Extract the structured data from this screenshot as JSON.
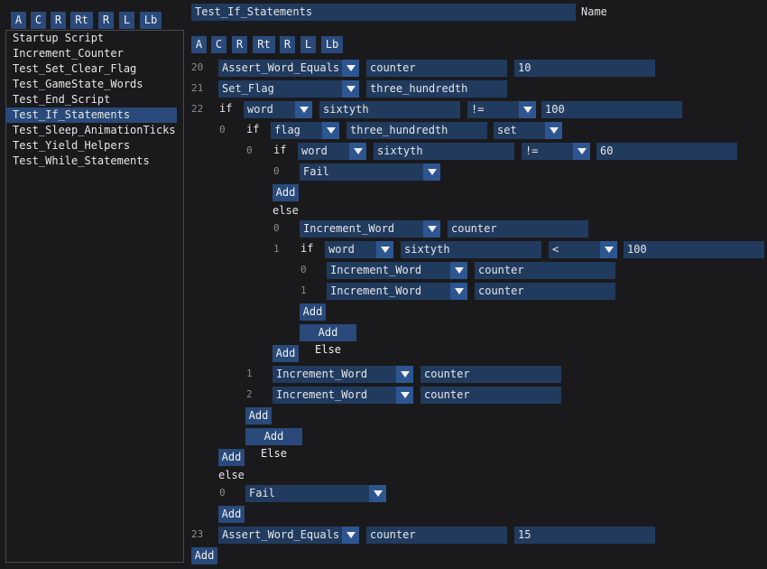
{
  "toolbar": [
    "A",
    "C",
    "R",
    "Rt",
    "R",
    "L",
    "Lb"
  ],
  "sidebar": {
    "items": [
      "Startup Script",
      "Increment_Counter",
      "Test_Set_Clear_Flag",
      "Test_GameState_Words",
      "Test_End_Script",
      "Test_If_Statements",
      "Test_Sleep_AnimationTicks",
      "Test_Yield_Helpers",
      "Test_While_Statements"
    ],
    "selected": 5
  },
  "header": {
    "script_name": "Test_If_Statements",
    "name_label": "Name"
  },
  "editor": {
    "toolbar": [
      "A",
      "C",
      "R",
      "Rt",
      "R",
      "L",
      "Lb"
    ],
    "nums": [
      "20",
      "21",
      "22",
      "0",
      "0",
      "0",
      "1",
      "0",
      "1",
      "1",
      "2",
      "0",
      "23"
    ],
    "keywords": [
      "if",
      "if",
      "if",
      "else",
      "if",
      "else"
    ],
    "add_label": "Add",
    "add_else_label": "Add Else",
    "combos": [
      "Assert_Word_Equals",
      "Set_Flag",
      "word",
      "!=",
      "flag",
      "set",
      "word",
      "!=",
      "Fail",
      "Increment_Word",
      "word",
      "<",
      "Increment_Word",
      "Increment_Word",
      "Increment_Word",
      "Increment_Word",
      "Fail",
      "Assert_Word_Equals"
    ],
    "fields": [
      "counter",
      "10",
      "three_hundredth",
      "sixtyth",
      "100",
      "three_hundredth",
      "sixtyth",
      "60",
      "counter",
      "sixtyth",
      "100",
      "counter",
      "counter",
      "counter",
      "counter",
      "counter",
      "15"
    ]
  }
}
